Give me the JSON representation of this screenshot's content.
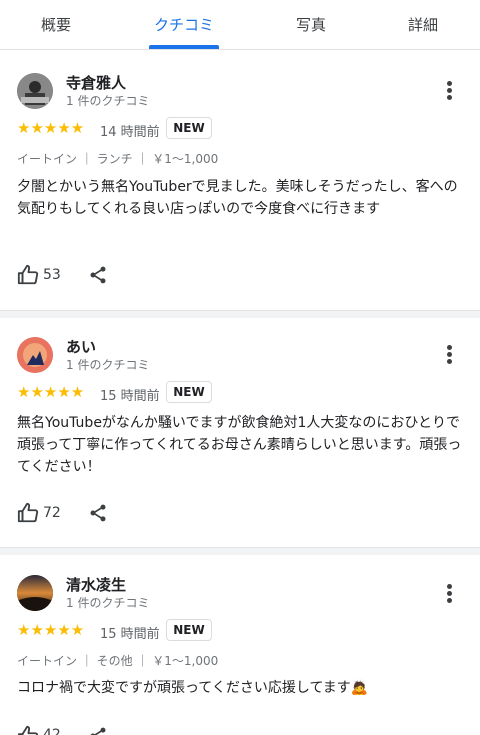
{
  "tabs": [
    {
      "label": "概要"
    },
    {
      "label": "クチコミ"
    },
    {
      "label": "写真"
    },
    {
      "label": "詳細"
    }
  ],
  "reviews": [
    {
      "name": "寺倉雅人",
      "count": "1 件のクチコミ",
      "stars": "★★★★★",
      "rating": 5,
      "time": "14 時間前",
      "badge": "NEW",
      "meta": "イートイン ｜ ランチ ｜ ￥1〜1,000",
      "text": "夕闇とかいう無名YouTuberで見ました。美味しそうだったし、客への気配りもしてくれる良い店っぽいので今度食べに行きます",
      "likes": "53"
    },
    {
      "name": "あい",
      "count": "1 件のクチコミ",
      "stars": "★★★★★",
      "rating": 5,
      "time": "15 時間前",
      "badge": "NEW",
      "text": "無名YouTubeがなんか騒いでますが飲食絶対1人大変なのにおひとりで頑張って丁寧に作ってくれてるお母さん素晴らしいと思います。頑張ってください！",
      "likes": "72"
    },
    {
      "name": "清水凌生",
      "count": "1 件のクチコミ",
      "stars": "★★★★★",
      "rating": 5,
      "time": "15 時間前",
      "badge": "NEW",
      "meta": "イートイン ｜ その他 ｜ ￥1〜1,000",
      "text": "コロナ禍で大変ですが頑張ってください応援してます🙇",
      "likes": "42"
    }
  ],
  "colors": {
    "accent": "#1a73e8",
    "star": "#fbbc04"
  }
}
